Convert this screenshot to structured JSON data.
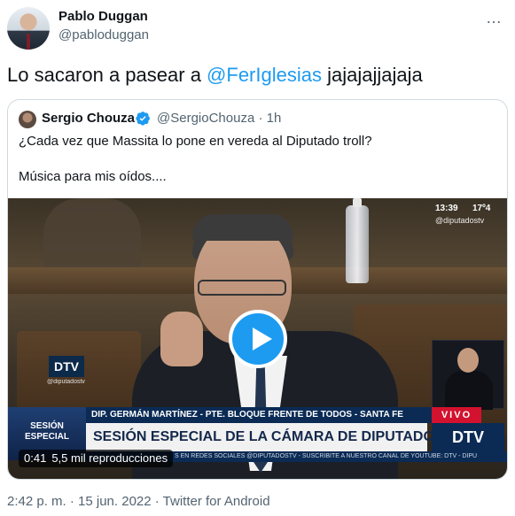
{
  "author": {
    "name": "Pablo Duggan",
    "handle": "@pabloduggan",
    "more_icon": "…"
  },
  "tweet": {
    "text_before": "Lo sacaron a pasear a ",
    "mention": "@FerIglesias",
    "text_after": " jajajajjajaja"
  },
  "quoted": {
    "name": "Sergio Chouza",
    "handle_time": "@SergioChouza · 1h",
    "line1": "¿Cada vez que Massita lo pone en vereda al Diputado troll?",
    "line2": "Música para mis oídos....",
    "video": {
      "clock": "13:39",
      "temp": "17º4",
      "channel": "@diputadostv",
      "dtv_small": "DTV",
      "dtv_small_sub": "@diputadostv",
      "sesion": "SESIÓN ESPECIAL",
      "name_bar": "DIP. GERMÁN MARTÍNEZ - PTE. BLOQUE FRENTE DE TODOS - SANTA FE",
      "title_bar": "SESIÓN ESPECIAL DE LA CÁMARA DE DIPUTADOS",
      "vivo": "VIVO",
      "dtv_big": "DTV",
      "ticker": "S EN REDES SOCIALES @DIPUTADOSTV - SUSCRIBITE A NUESTRO CANAL DE YOUTUBE: DTV - DIPU",
      "duration": "0:41",
      "views": "5,5 mil reproducciones"
    }
  },
  "footer": {
    "timestamp": "2:42 p. m. · 15 jun. 2022 · Twitter for Android"
  }
}
